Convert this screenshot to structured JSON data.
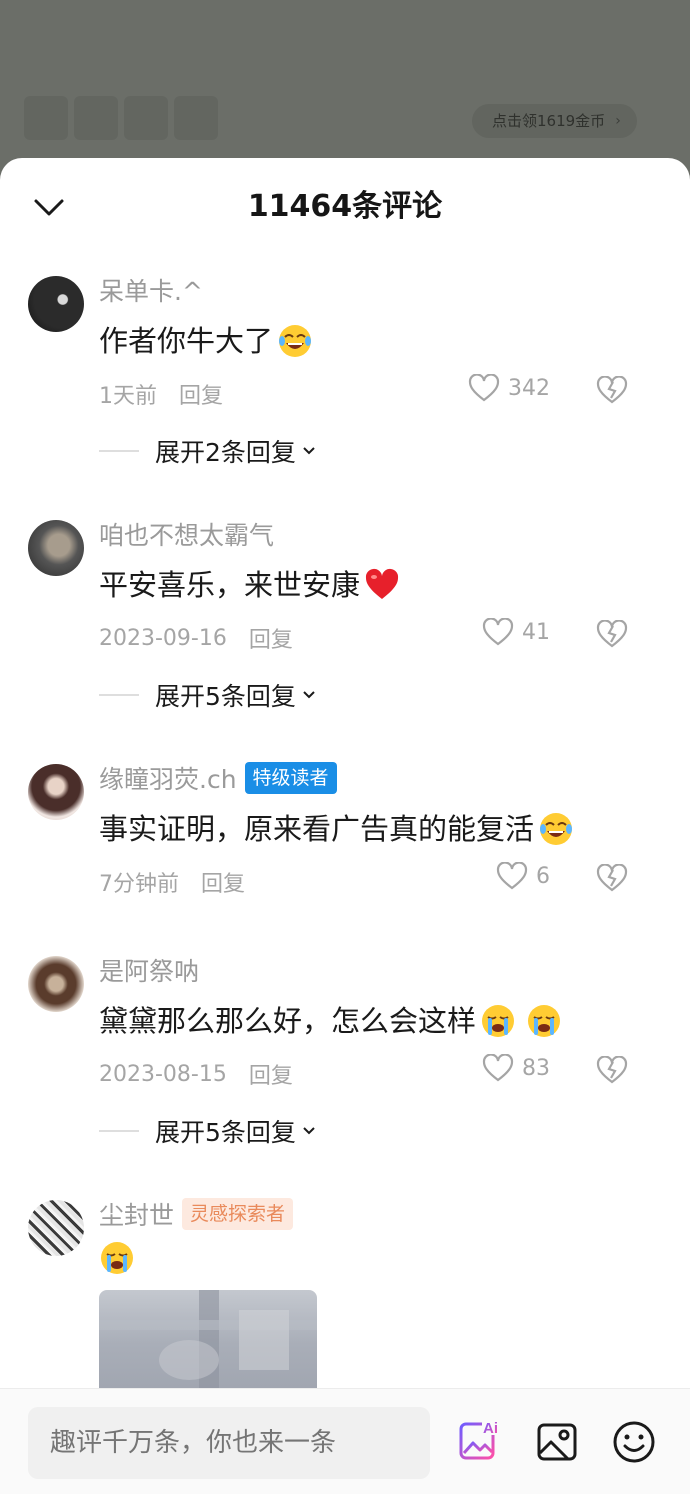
{
  "background": {
    "coin_pill": "点击领1619金币"
  },
  "sheet": {
    "title": "11464条评论"
  },
  "comments": [
    {
      "username": "呆单卡.^",
      "content": "作者你牛大了",
      "emoji": "laughing-tears",
      "time": "1天前",
      "reply": "回复",
      "likes": "342",
      "expand": "展开2条回复"
    },
    {
      "username": "咱也不想太霸气",
      "content": "平安喜乐，来世安康",
      "emoji": "red-heart",
      "time": "2023-09-16",
      "reply": "回复",
      "likes": "41",
      "expand": "展开5条回复"
    },
    {
      "username": "缘瞳羽荧.ch",
      "badge": "特级读者",
      "content": "事实证明，原来看广告真的能复活",
      "emoji": "laughing-tears",
      "time": "7分钟前",
      "reply": "回复",
      "likes": "6"
    },
    {
      "username": "是阿祭呐",
      "content": "黛黛那么那么好，怎么会这样",
      "emoji": "crying",
      "time": "2023-08-15",
      "reply": "回复",
      "likes": "83",
      "expand": "展开5条回复"
    },
    {
      "username": "尘封世",
      "badge": "灵感探索者",
      "emoji": "crying"
    }
  ],
  "bottom_bar": {
    "input_placeholder": "趣评千万条，你也来一条",
    "ai_icon_label": "Ai"
  },
  "colors": {
    "badge_blue": "#1a8ee6",
    "badge_orange_bg": "#fde9df",
    "badge_orange_text": "#e98a5b",
    "ai_icon_gradient": [
      "#6f5cff",
      "#ff4fa7"
    ]
  }
}
